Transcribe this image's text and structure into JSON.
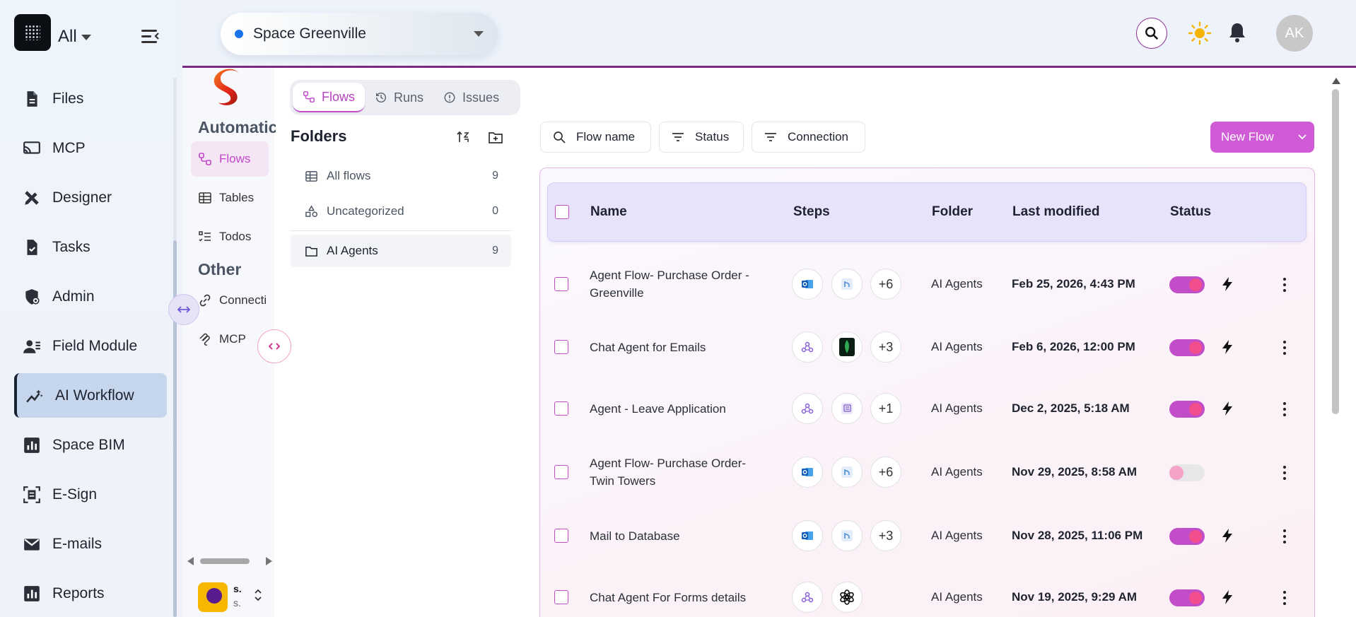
{
  "global_sidebar": {
    "workspace_label": "All",
    "items": [
      {
        "label": "Files",
        "icon": "file-icon"
      },
      {
        "label": "MCP",
        "icon": "cast-icon"
      },
      {
        "label": "Designer",
        "icon": "design-tools-icon"
      },
      {
        "label": "Tasks",
        "icon": "task-check-icon"
      },
      {
        "label": "Admin",
        "icon": "admin-shield-icon"
      },
      {
        "label": "Field Module",
        "icon": "field-users-icon"
      },
      {
        "label": "AI Workflow",
        "icon": "workflow-trend-icon",
        "active": true
      },
      {
        "label": "Space BIM",
        "icon": "bar-chart-icon"
      },
      {
        "label": "E-Sign",
        "icon": "esign-doc-icon"
      },
      {
        "label": "E-mails",
        "icon": "mail-icon"
      },
      {
        "label": "Reports",
        "icon": "reports-chart-icon"
      }
    ]
  },
  "topbar": {
    "space_name": "Space Greenville",
    "avatar_initials": "AK"
  },
  "app_sidebar": {
    "section_automation": "Automatic",
    "items_automation": [
      {
        "label": "Flows",
        "active": true
      },
      {
        "label": "Tables"
      },
      {
        "label": "Todos"
      }
    ],
    "section_other": "Other",
    "items_other": [
      {
        "label": "Connecti"
      },
      {
        "label": "MCP"
      }
    ],
    "user_name": "s.",
    "user_sub": "s."
  },
  "tabs": [
    {
      "label": "Flows",
      "active": true
    },
    {
      "label": "Runs"
    },
    {
      "label": "Issues"
    }
  ],
  "folders": {
    "title": "Folders",
    "items": [
      {
        "label": "All flows",
        "count": "9"
      },
      {
        "label": "Uncategorized",
        "count": "0"
      },
      {
        "label": "AI Agents",
        "count": "9",
        "active": true
      }
    ]
  },
  "filters": {
    "flow_name": "Flow name",
    "status": "Status",
    "connection": "Connection",
    "new_flow": "New Flow"
  },
  "table": {
    "headers": {
      "name": "Name",
      "steps": "Steps",
      "folder": "Folder",
      "last_modified": "Last modified",
      "status": "Status"
    },
    "rows": [
      {
        "name": "Agent Flow- Purchase Order - Greenville",
        "steps_extra": "+6",
        "folder": "AI Agents",
        "modified": "Feb 25, 2026, 4:43 PM",
        "enabled": true
      },
      {
        "name": "Chat Agent for Emails",
        "steps_extra": "+3",
        "folder": "AI Agents",
        "modified": "Feb 6, 2026, 12:00 PM",
        "enabled": true
      },
      {
        "name": "Agent - Leave Application",
        "steps_extra": "+1",
        "folder": "AI Agents",
        "modified": "Dec 2, 2025, 5:18 AM",
        "enabled": true
      },
      {
        "name": "Agent Flow- Purchase Order- Twin Towers",
        "steps_extra": "+6",
        "folder": "AI Agents",
        "modified": "Nov 29, 2025, 8:58 AM",
        "enabled": false
      },
      {
        "name": "Mail to Database",
        "steps_extra": "+3",
        "folder": "AI Agents",
        "modified": "Nov 28, 2025, 11:06 PM",
        "enabled": true
      },
      {
        "name": "Chat Agent For Forms details",
        "steps_extra": "",
        "folder": "AI Agents",
        "modified": "Nov 19, 2025, 9:29 AM",
        "enabled": true
      }
    ]
  },
  "colors": {
    "accent": "#c24dc9",
    "toggle_knob": "#f24d8c",
    "sidebar_active": "#c6d6ec"
  }
}
